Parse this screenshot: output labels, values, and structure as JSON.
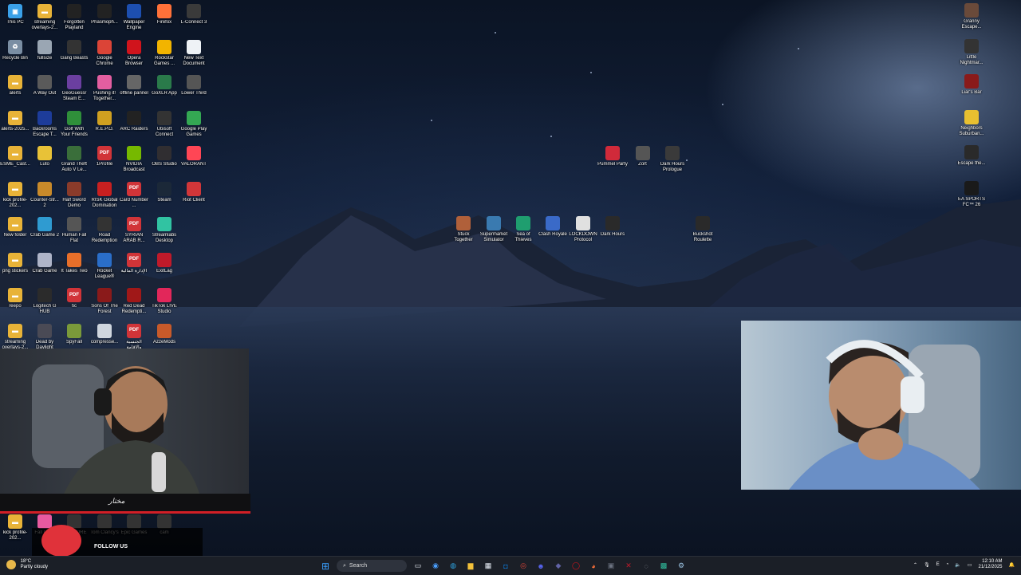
{
  "desktop": {
    "icons_col1": [
      {
        "label": "This PC",
        "icon": "this-pc-icon",
        "color": "#3aa0e8"
      },
      {
        "label": "Recycle Bin",
        "icon": "recycle-bin-icon",
        "color": "#7a8ea3"
      },
      {
        "label": "alerts",
        "icon": "folder-icon",
        "color": "#e8b338"
      },
      {
        "label": "alerts-2025...",
        "icon": "folder-icon",
        "color": "#e8b338"
      },
      {
        "label": "ESME_Cast...",
        "icon": "folder-icon",
        "color": "#e8b338"
      },
      {
        "label": "kick profile-202...",
        "icon": "folder-icon",
        "color": "#e8b338"
      },
      {
        "label": "New folder",
        "icon": "folder-icon",
        "color": "#e8b338"
      },
      {
        "label": "png stickers",
        "icon": "folder-icon",
        "color": "#e8b338"
      },
      {
        "label": "reepo",
        "icon": "folder-icon",
        "color": "#e8b338"
      },
      {
        "label": "streaming overlays-2...",
        "icon": "folder-icon",
        "color": "#e8b338"
      }
    ],
    "icons_col2": [
      {
        "label": "streaming overlays-2...",
        "icon": "folder-icon",
        "color": "#e8b338"
      },
      {
        "label": "fullsize",
        "icon": "image-icon",
        "color": "#9aa6b3"
      },
      {
        "label": "A Way Out",
        "icon": "game-icon",
        "color": "#5a5a5a"
      },
      {
        "label": "Backrooms Escape T...",
        "icon": "game-icon",
        "color": "#1d3c9a"
      },
      {
        "label": "Luto",
        "icon": "game-icon",
        "color": "#e8c237"
      },
      {
        "label": "Counter-Str... 2",
        "icon": "game-icon",
        "color": "#c98a2a"
      },
      {
        "label": "Crab Game 2",
        "icon": "game-icon",
        "color": "#2f9bd1"
      },
      {
        "label": "Crab Game",
        "icon": "game-icon",
        "color": "#aeb4c8"
      },
      {
        "label": "Logitech G HUB",
        "icon": "logitech-icon",
        "color": "#2b2b2b"
      },
      {
        "label": "Dead by Daylight",
        "icon": "game-icon",
        "color": "#4a4a55"
      }
    ],
    "icons_col3": [
      {
        "label": "Forgotten Playland",
        "icon": "epic-icon",
        "color": "#222"
      },
      {
        "label": "Gang Beasts",
        "icon": "game-icon",
        "color": "#333"
      },
      {
        "label": "GeoGuessr Steam E...",
        "icon": "game-icon",
        "color": "#6b3fa0"
      },
      {
        "label": "Golf With Your Friends",
        "icon": "game-icon",
        "color": "#2f8f3a"
      },
      {
        "label": "Grand Theft Auto V Le...",
        "icon": "game-icon",
        "color": "#3a6e3a"
      },
      {
        "label": "Half Sword Demo",
        "icon": "game-icon",
        "color": "#8a3b2a"
      },
      {
        "label": "Human Fall Flat",
        "icon": "game-icon",
        "color": "#555"
      },
      {
        "label": "It Takes Two",
        "icon": "game-icon",
        "color": "#e86f2a"
      },
      {
        "label": "tic",
        "icon": "pdf-icon",
        "color": "#d13438"
      },
      {
        "label": "SpyFall",
        "icon": "game-icon",
        "color": "#7a9a3a"
      }
    ],
    "icons_col4": [
      {
        "label": "Phasmoph...",
        "icon": "game-icon",
        "color": "#222"
      },
      {
        "label": "Google Chrome",
        "icon": "chrome-icon",
        "color": "#db4437"
      },
      {
        "label": "Pushing it! Together...",
        "icon": "game-icon",
        "color": "#e35ea0"
      },
      {
        "label": "R.E.P.O.",
        "icon": "game-icon",
        "color": "#d0a020"
      },
      {
        "label": "1Profile",
        "icon": "pdf-icon",
        "color": "#d13438"
      },
      {
        "label": "RISK Global Domination",
        "icon": "game-icon",
        "color": "#c82020"
      },
      {
        "label": "Road Redemption",
        "icon": "game-icon",
        "color": "#333"
      },
      {
        "label": "Rocket League®",
        "icon": "game-icon",
        "color": "#2a6ec9"
      },
      {
        "label": "Sons Of The Forest",
        "icon": "game-icon",
        "color": "#8a1a1a"
      },
      {
        "label": "compresse...",
        "icon": "file-icon",
        "color": "#cfd6de"
      }
    ],
    "icons_col5": [
      {
        "label": "Wallpaper Engine",
        "icon": "wallpaper-engine-icon",
        "color": "#1d4fb0"
      },
      {
        "label": "Opera Browser",
        "icon": "opera-icon",
        "color": "#d0141c"
      },
      {
        "label": "offline pannel",
        "icon": "app-icon",
        "color": "#666"
      },
      {
        "label": "ARC Raiders",
        "icon": "game-icon",
        "color": "#222"
      },
      {
        "label": "NVIDIA Broadcast",
        "icon": "nvidia-icon",
        "color": "#76b900"
      },
      {
        "label": "Card Number ...",
        "icon": "pdf-icon",
        "color": "#d13438"
      },
      {
        "label": "SYRIAN ARAB R...",
        "icon": "pdf-icon",
        "color": "#d13438"
      },
      {
        "label": "الإدارة المالية",
        "icon": "pdf-icon",
        "color": "#d13438"
      },
      {
        "label": "Red Dead Redempti...",
        "icon": "game-icon",
        "color": "#a01818"
      },
      {
        "label": "الجنسية والإقامة",
        "icon": "pdf-icon",
        "color": "#d13438"
      }
    ],
    "icons_col6": [
      {
        "label": "Firefox",
        "icon": "firefox-icon",
        "color": "#ff7139"
      },
      {
        "label": "Rockstar Games ...",
        "icon": "rockstar-icon",
        "color": "#f2b400"
      },
      {
        "label": "GoXLR App",
        "icon": "app-icon",
        "color": "#2a7a4a"
      },
      {
        "label": "Ubisoft Connect",
        "icon": "ubisoft-icon",
        "color": "#333"
      },
      {
        "label": "OBS Studio",
        "icon": "obs-icon",
        "color": "#302e31"
      },
      {
        "label": "Steam",
        "icon": "steam-icon",
        "color": "#1b2838"
      },
      {
        "label": "Streamlabs Desktop",
        "icon": "streamlabs-icon",
        "color": "#31c3a2"
      },
      {
        "label": "ExitLag",
        "icon": "exitlag-icon",
        "color": "#c01a2a"
      },
      {
        "label": "TikTok LIVE Studio",
        "icon": "tiktok-icon",
        "color": "#e2275a"
      },
      {
        "label": "AzzeMods",
        "icon": "app-icon",
        "color": "#c85a2a"
      }
    ],
    "icons_col7": [
      {
        "label": "L-Connect 3",
        "icon": "app-icon",
        "color": "#3a3a3a"
      },
      {
        "label": "New Text Document",
        "icon": "text-file-icon",
        "color": "#eef2f6"
      },
      {
        "label": "Lower Third",
        "icon": "app-icon",
        "color": "#555"
      },
      {
        "label": "Google Play Games",
        "icon": "google-play-icon",
        "color": "#34a853"
      },
      {
        "label": "VALORANT",
        "icon": "valorant-icon",
        "color": "#ff4655"
      },
      {
        "label": "Riot Client",
        "icon": "riot-icon",
        "color": "#d13639"
      }
    ],
    "icons_middle_row1": [
      {
        "label": "Pummel Party",
        "icon": "game-icon",
        "color": "#d02a3a"
      },
      {
        "label": "Zort",
        "icon": "game-icon",
        "color": "#555"
      },
      {
        "label": "Dark Hours Prologue",
        "icon": "game-icon",
        "color": "#3a3a3a"
      }
    ],
    "icons_middle_row2": [
      {
        "label": "Stuck Together",
        "icon": "game-icon",
        "color": "#b0603a"
      },
      {
        "label": "Supermarket Simulator",
        "icon": "game-icon",
        "color": "#3a7ab0"
      },
      {
        "label": "Sea of Thieves",
        "icon": "game-icon",
        "color": "#1f9e6f"
      },
      {
        "label": "Clash Royale",
        "icon": "game-icon",
        "color": "#3a6ac8"
      },
      {
        "label": "LOCKDOWN Protocol",
        "icon": "game-icon",
        "color": "#e0e0e0"
      },
      {
        "label": "Dark Hours",
        "icon": "game-icon",
        "color": "#2a2a2a"
      },
      {
        "label": "Buckshot Roulette",
        "icon": "game-icon",
        "color": "#2a2a2a"
      }
    ],
    "icons_right": [
      {
        "label": "Granny Escape...",
        "icon": "game-icon",
        "color": "#6a4a3a"
      },
      {
        "label": "Little Nightmar...",
        "icon": "game-icon",
        "color": "#333"
      },
      {
        "label": "Liar's Bar",
        "icon": "game-icon",
        "color": "#8a1a1a"
      },
      {
        "label": "Neighbors Suburban...",
        "icon": "game-icon",
        "color": "#e8c030"
      },
      {
        "label": "Escape the...",
        "icon": "game-icon",
        "color": "#2a2a2a"
      },
      {
        "label": "EA SPORTS FC™ 26",
        "icon": "game-icon",
        "color": "#1a1a1a"
      }
    ],
    "icons_bottom": [
      {
        "label": "kick profile-202...",
        "icon": "folder-icon",
        "color": "#e8b338"
      },
      {
        "label": "Fall Guys",
        "icon": "game-icon",
        "color": "#e85aa0"
      },
      {
        "label": "PANICORE",
        "icon": "game-icon",
        "color": "#333"
      },
      {
        "label": "Tom Clancy's",
        "icon": "game-icon",
        "color": "#333"
      },
      {
        "label": "Epic Games",
        "icon": "epic-icon",
        "color": "#333"
      },
      {
        "label": "cam",
        "icon": "app-icon",
        "color": "#333"
      }
    ]
  },
  "overlay": {
    "follow_text": "FOLLOW US"
  },
  "taskbar": {
    "weather_temp": "18°C",
    "weather_desc": "Partly cloudy",
    "search_placeholder": "Search",
    "apps": [
      {
        "name": "task-view-icon",
        "color": "#e9eef5",
        "glyph": "▭"
      },
      {
        "name": "copilot-icon",
        "color": "#4aa0ff",
        "glyph": "◉"
      },
      {
        "name": "edge-icon",
        "color": "#2fa4e2",
        "glyph": "◍"
      },
      {
        "name": "file-explorer-icon",
        "color": "#f3c13a",
        "glyph": "▆"
      },
      {
        "name": "store-icon",
        "color": "#e8eef7",
        "glyph": "▦"
      },
      {
        "name": "outlook-icon",
        "color": "#0f6cbd",
        "glyph": "◘"
      },
      {
        "name": "chrome-icon",
        "color": "#db4437",
        "glyph": "◎"
      },
      {
        "name": "discord-icon",
        "color": "#5865f2",
        "glyph": "☻"
      },
      {
        "name": "teams-icon",
        "color": "#6264a7",
        "glyph": "◆"
      },
      {
        "name": "opera-icon",
        "color": "#d0141c",
        "glyph": "◯"
      },
      {
        "name": "firefox-icon",
        "color": "#ff7139",
        "glyph": "◕"
      },
      {
        "name": "goxlr-icon",
        "color": "#6b7280",
        "glyph": "▣"
      },
      {
        "name": "exitlag-icon",
        "color": "#c01a2a",
        "glyph": "✕"
      },
      {
        "name": "obs-icon",
        "color": "#9aa1aa",
        "glyph": "◌"
      },
      {
        "name": "streamlabs-icon",
        "color": "#31c3a2",
        "glyph": "▩"
      },
      {
        "name": "steam-icon",
        "color": "#9cc4e4",
        "glyph": "⚙"
      }
    ],
    "time": "12:10 AM",
    "date": "21/12/2025",
    "language": "E"
  }
}
